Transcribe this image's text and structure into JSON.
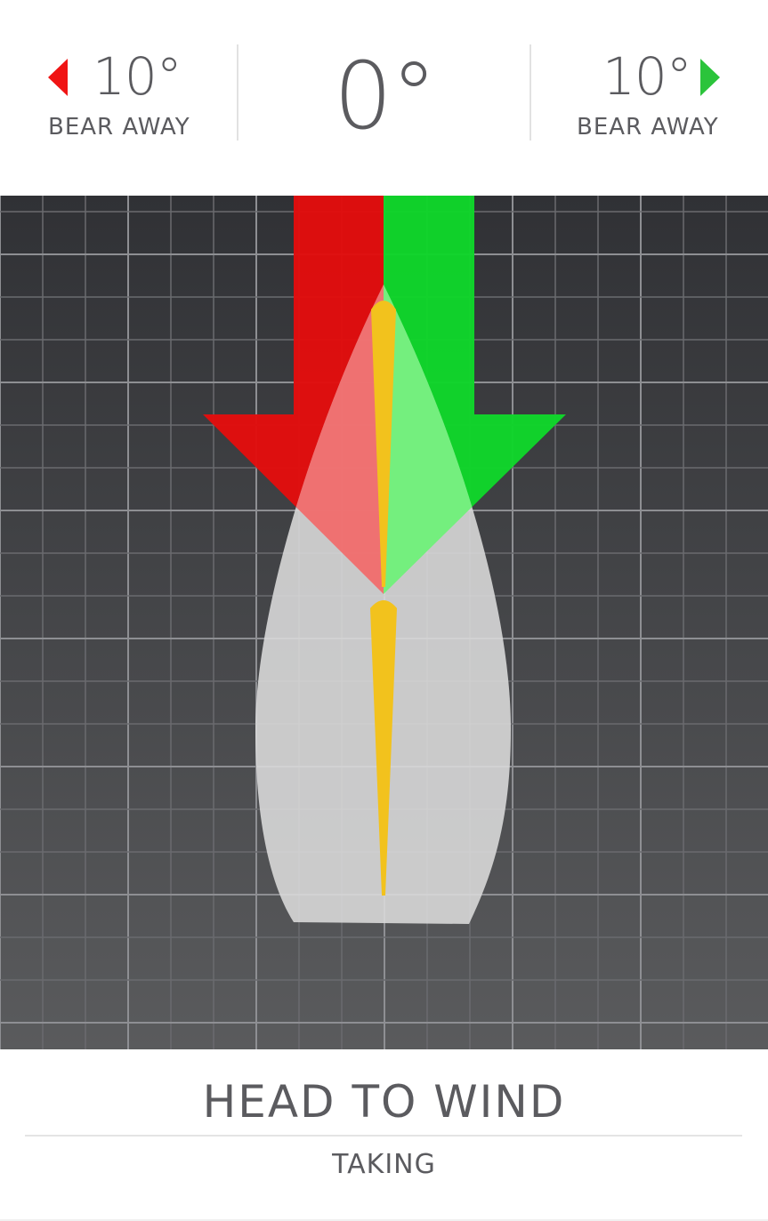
{
  "header": {
    "left": {
      "value": "10°",
      "label": "BEAR AWAY",
      "icon": "left-triangle-icon",
      "color": "#f01414"
    },
    "center": {
      "value": "0°"
    },
    "right": {
      "value": "10°",
      "label": "BEAR AWAY",
      "icon": "right-triangle-icon",
      "color": "#2bc43b"
    }
  },
  "visual": {
    "hull_color": "#dcdcdc",
    "mast_color": "#f2c21d",
    "port_arrow_color": "#e20d0d",
    "starboard_arrow_color": "#0fd62a",
    "grid_background": "#3c3d41"
  },
  "footer": {
    "mode": "HEAD TO WIND",
    "status": "TAKING"
  }
}
